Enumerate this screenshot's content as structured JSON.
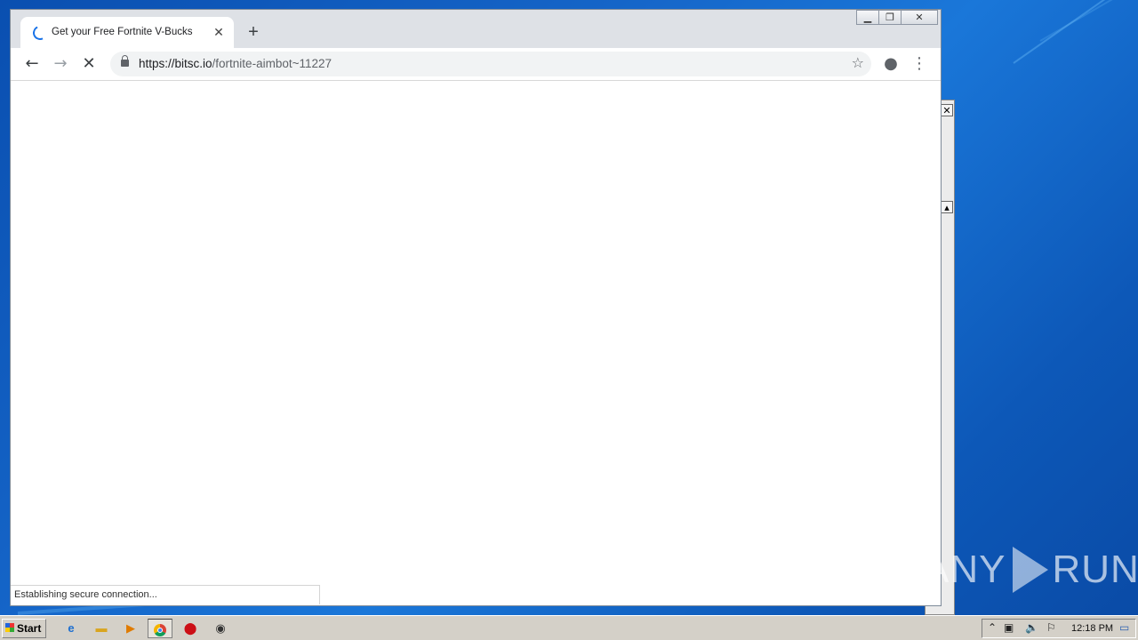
{
  "browser": {
    "tab_title": "Get your Free Fortnite V-Bucks",
    "url_host": "https://bitsc.io",
    "url_path": "/fortnite-aimbot~11227",
    "status_text": "Establishing secure connection..."
  },
  "icons": {
    "tab_close": "close-icon",
    "new_tab": "plus-icon",
    "back": "arrow-left-icon",
    "forward": "arrow-right-icon",
    "stop": "stop-icon",
    "bookmark": "star-icon",
    "profile": "account-icon",
    "menu": "kebab-menu-icon"
  },
  "taskbar": {
    "start_label": "Start",
    "clock": "12:18 PM"
  },
  "watermark": {
    "left": "ANY",
    "right": "RUN"
  },
  "colors": {
    "desktop": "#1565c8",
    "spinner": "#1a73e8",
    "titlebar": "#dee1e6"
  }
}
